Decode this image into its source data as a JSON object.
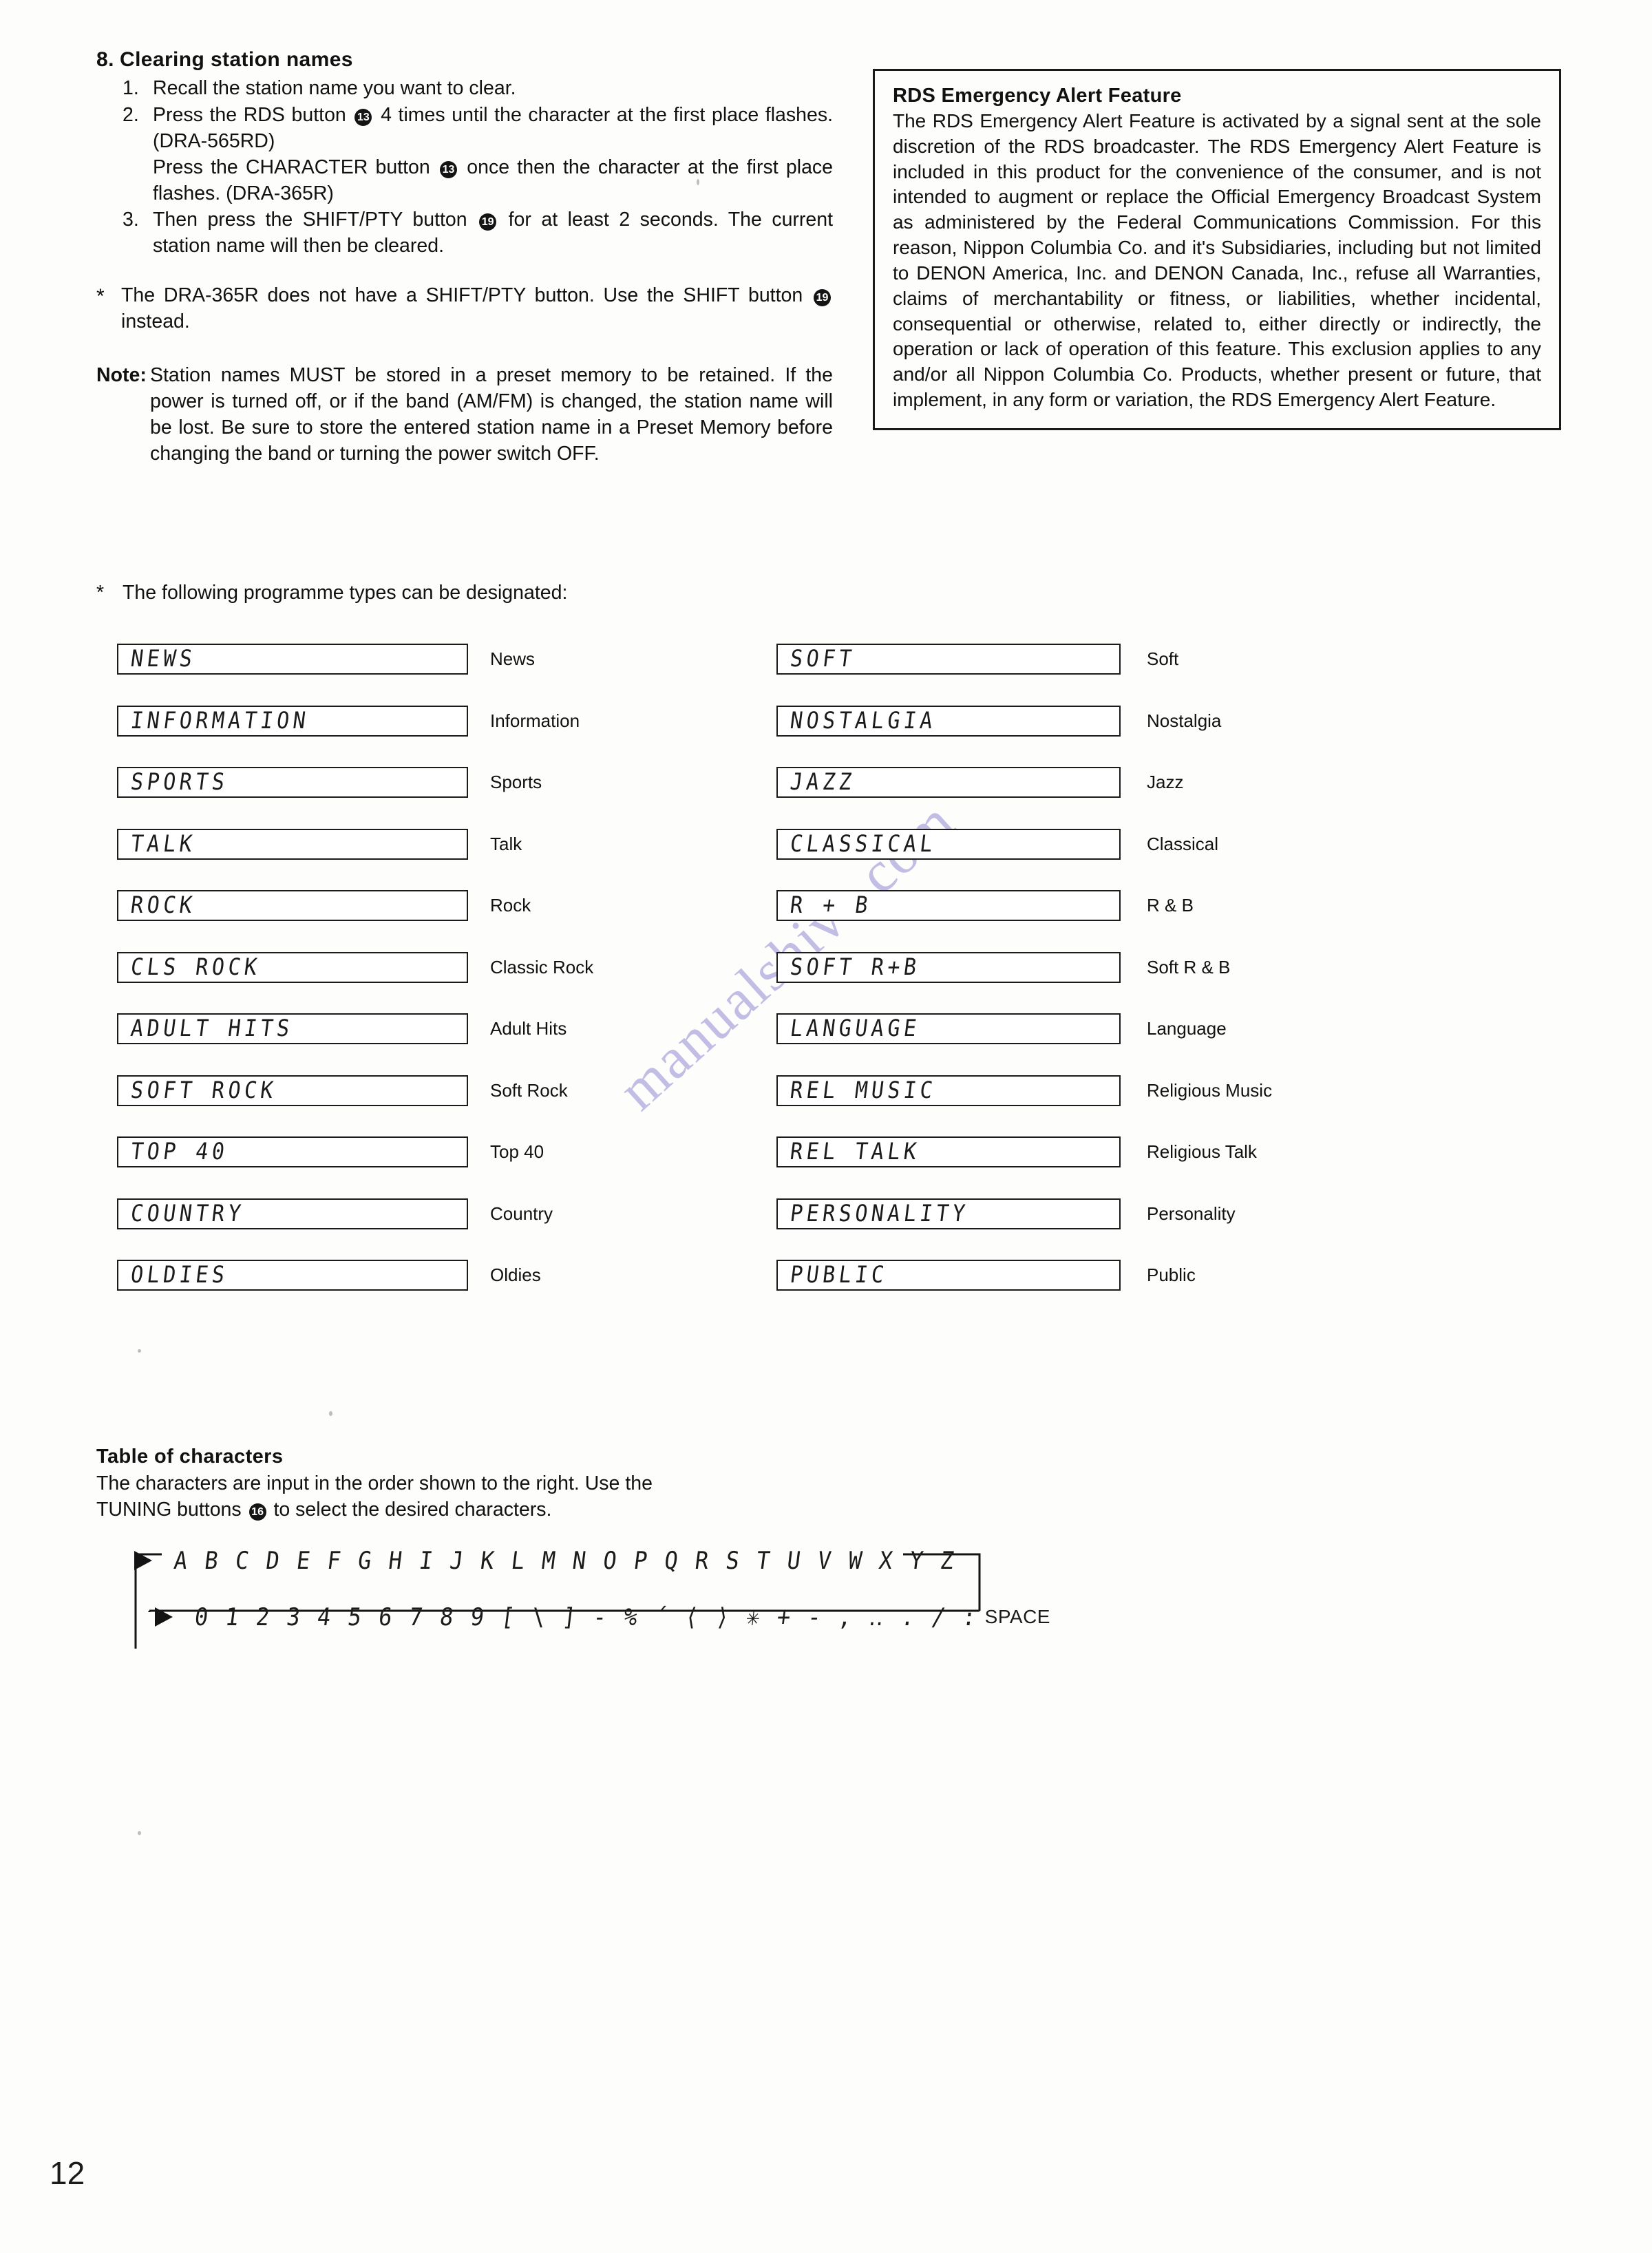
{
  "document": {
    "page_number": "12",
    "watermark": "manualshive.com"
  },
  "section": {
    "number": "8.",
    "title": "Clearing station names",
    "steps": [
      {
        "label": "1.",
        "lines": [
          "Recall the station name you want to clear."
        ]
      },
      {
        "label": "2.",
        "lines": [
          "Press the RDS button ⑬ 4 times until the character at the first place flashes. (DRA-565RD)",
          "Press the CHARACTER button ⑬ once then the character at the first place flashes. (DRA-365R)"
        ]
      },
      {
        "label": "3.",
        "lines": [
          "Then press the SHIFT/PTY button ⑲ for at least 2 seconds. The current station name will then be cleared."
        ]
      }
    ],
    "step2_part1_pre": "Press the RDS button",
    "step2_part1_badge": "13",
    "step2_part1_post": "4 times until the character at the first place flashes. (DRA-565RD)",
    "step2_part2_pre": "Press the CHARACTER button",
    "step2_part2_badge": "13",
    "step2_part2_post": "once then the character at the first place flashes. (DRA-365R)",
    "step3_pre": "Then press the SHIFT/PTY button",
    "step3_badge": "19",
    "step3_post": "for at least 2 seconds. The current station name will then be cleared.",
    "step1_text": "Recall the station name you want to clear.",
    "asterisk_note": {
      "mark": "*",
      "pre": "The DRA-365R does not have a SHIFT/PTY button. Use the SHIFT button",
      "badge": "19",
      "post": "instead."
    },
    "note": {
      "mark": "Note:",
      "text": "Station names MUST be stored in a preset memory to be retained. If the power is turned off, or if the band (AM/FM) is changed, the station name will be lost. Be sure to store the entered station name in a Preset Memory before changing the band or turning the power switch OFF."
    }
  },
  "rds_box": {
    "title": "RDS Emergency Alert Feature",
    "body": "The RDS Emergency Alert Feature is activated by a signal sent at the sole discretion of the RDS broadcaster. The RDS Emergency Alert Feature is included in this product for the convenience of the consumer, and is not intended to augment or replace the Official Emergency Broadcast System as administered by the Federal Communications Commission. For this reason, Nippon Columbia Co. and it's Subsidiaries, including but not limited to DENON America, Inc. and DENON Canada, Inc., refuse all Warranties, claims of merchantability or fitness, or liabilities, whether incidental, consequential or otherwise, related to, either directly or indirectly, the operation or lack of operation of this feature. This exclusion applies to any and/or all Nippon Columbia Co. Products, whether present or future, that implement, in any form or variation, the RDS Emergency Alert Feature."
  },
  "programme_types": {
    "intro_mark": "*",
    "intro": "The following programme types can be designated:",
    "left_column": [
      {
        "display": "NEWS",
        "label": "News"
      },
      {
        "display": "INFORMATION",
        "label": "Information"
      },
      {
        "display": "SPORTS",
        "label": "Sports"
      },
      {
        "display": "TALK",
        "label": "Talk"
      },
      {
        "display": "ROCK",
        "label": "Rock"
      },
      {
        "display": "CLS ROCK",
        "label": "Classic Rock"
      },
      {
        "display": "ADULT HITS",
        "label": "Adult Hits"
      },
      {
        "display": "SOFT ROCK",
        "label": "Soft Rock"
      },
      {
        "display": "TOP 40",
        "label": "Top 40"
      },
      {
        "display": "COUNTRY",
        "label": "Country"
      },
      {
        "display": "OLDIES",
        "label": "Oldies"
      }
    ],
    "right_column": [
      {
        "display": "SOFT",
        "label": "Soft"
      },
      {
        "display": "NOSTALGIA",
        "label": "Nostalgia"
      },
      {
        "display": "JAZZ",
        "label": "Jazz"
      },
      {
        "display": "CLASSICAL",
        "label": "Classical"
      },
      {
        "display": "R + B",
        "label": "R & B"
      },
      {
        "display": "SOFT R+B",
        "label": "Soft R & B"
      },
      {
        "display": "LANGUAGE",
        "label": "Language"
      },
      {
        "display": "REL MUSIC",
        "label": "Religious Music"
      },
      {
        "display": "REL TALK",
        "label": "Religious Talk"
      },
      {
        "display": "PERSONALITY",
        "label": "Personality"
      },
      {
        "display": "PUBLIC",
        "label": "Public"
      }
    ]
  },
  "table_of_characters": {
    "title": "Table of characters",
    "description_line1": "The characters are input in the order shown to the right. Use the",
    "description_line2_pre": "TUNING buttons",
    "description_badge": "16",
    "description_line2_post": "to select the desired characters.",
    "row1": "A B C D E F G H I J K L M N O P Q R S T U V W X Y Z",
    "row2": "0 1 2 3 4 5 6 7 8 9 [ \\ ] - % ´ ⟨ ⟩ ✳ + - , ‥ . / :",
    "row2_space_label": "SPACE"
  }
}
